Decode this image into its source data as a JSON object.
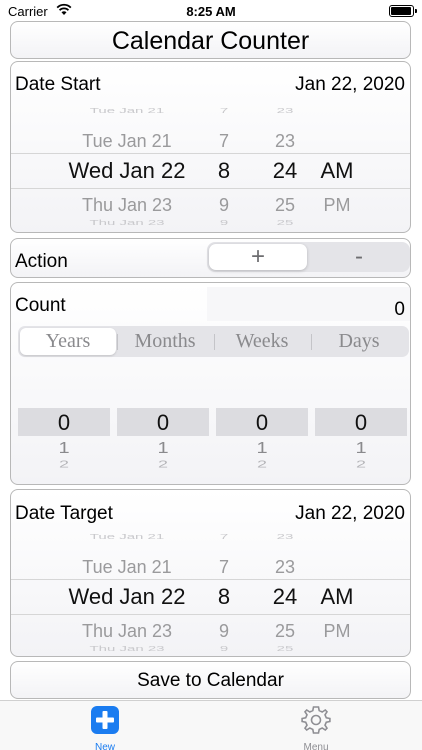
{
  "status_bar": {
    "carrier": "Carrier",
    "time": "8:25 AM",
    "battery_level": 0.95
  },
  "title": "Calendar Counter",
  "date_start": {
    "label": "Date Start",
    "value": "Jan 22, 2020",
    "picker": {
      "prev": {
        "day": "Tue Jan 21",
        "hour": "7",
        "minute": "23",
        "ampm": ""
      },
      "selected": {
        "day": "Wed Jan 22",
        "hour": "8",
        "minute": "24",
        "ampm": "AM"
      },
      "next": {
        "day": "Thu Jan 23",
        "hour": "9",
        "minute": "25",
        "ampm": "PM"
      }
    }
  },
  "action": {
    "label": "Action",
    "options": [
      "+",
      "-"
    ],
    "selected": "+"
  },
  "count": {
    "label": "Count",
    "value": "0",
    "units": [
      "Years",
      "Months",
      "Weeks",
      "Days"
    ],
    "selected_unit": "Years",
    "wheels": [
      {
        "values": [
          "0",
          "1",
          "2"
        ]
      },
      {
        "values": [
          "0",
          "1",
          "2"
        ]
      },
      {
        "values": [
          "0",
          "1",
          "2"
        ]
      },
      {
        "values": [
          "0",
          "1",
          "2"
        ]
      }
    ]
  },
  "date_target": {
    "label": "Date Target",
    "value": "Jan 22, 2020",
    "picker": {
      "prev": {
        "day": "Tue Jan 21",
        "hour": "7",
        "minute": "23",
        "ampm": ""
      },
      "selected": {
        "day": "Wed Jan 22",
        "hour": "8",
        "minute": "24",
        "ampm": "AM"
      },
      "next": {
        "day": "Thu Jan 23",
        "hour": "9",
        "minute": "25",
        "ampm": "PM"
      }
    }
  },
  "save_button": "Save to Calendar",
  "tabbar": {
    "items": [
      {
        "label": "New",
        "icon": "plus-square-icon",
        "color": "#1a7cf0",
        "active": true
      },
      {
        "label": "Menu",
        "icon": "gear-icon",
        "color": "#8e8e93",
        "active": false
      }
    ]
  },
  "colors": {
    "accent": "#1a7cf0",
    "inactive": "#8e8e93"
  }
}
